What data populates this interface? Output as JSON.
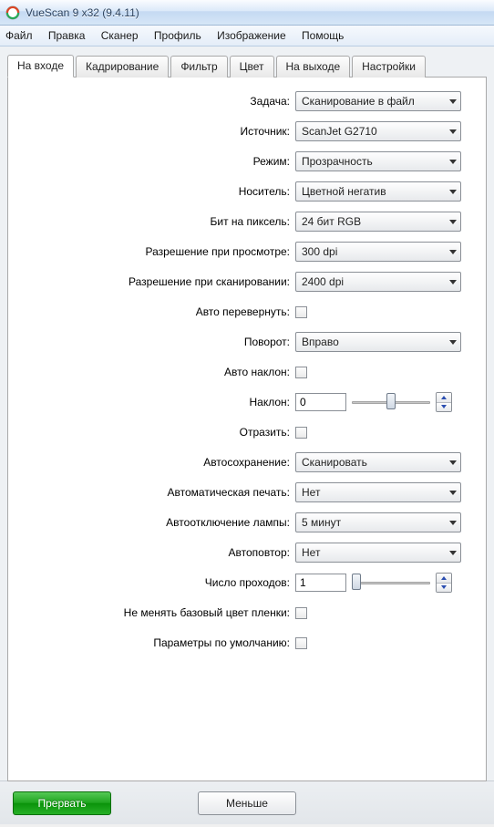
{
  "title": "VueScan 9 x32 (9.4.11)",
  "menu": [
    "Файл",
    "Правка",
    "Сканер",
    "Профиль",
    "Изображение",
    "Помощь"
  ],
  "tabs": [
    "На входе",
    "Кадрирование",
    "Фильтр",
    "Цвет",
    "На выходе",
    "Настройки"
  ],
  "active_tab": 0,
  "labels": {
    "task": "Задача:",
    "source": "Источник:",
    "mode": "Режим:",
    "media": "Носитель:",
    "bits": "Бит на пиксель:",
    "preview_res": "Разрешение при просмотре:",
    "scan_res": "Разрешение при сканировании:",
    "auto_flip": "Авто перевернуть:",
    "rotate": "Поворот:",
    "auto_skew": "Авто наклон:",
    "skew": "Наклон:",
    "mirror": "Отразить:",
    "autosave": "Автосохранение:",
    "autoprint": "Автоматическая печать:",
    "lamp_off": "Автоотключение лампы:",
    "autorepeat": "Автоповтор:",
    "passes": "Число проходов:",
    "keep_base": "Не менять базовый цвет пленки:",
    "defaults": "Параметры по умолчанию:"
  },
  "values": {
    "task": "Сканирование в файл",
    "source": "ScanJet G2710",
    "mode": "Прозрачность",
    "media": "Цветной негатив",
    "bits": "24 бит RGB",
    "preview_res": "300 dpi",
    "scan_res": "2400 dpi",
    "rotate": "Вправо",
    "skew": "0",
    "autosave": "Сканировать",
    "autoprint": "Нет",
    "lamp_off": "5 минут",
    "autorepeat": "Нет",
    "passes": "1"
  },
  "buttons": {
    "abort": "Прервать",
    "less": "Меньше"
  }
}
